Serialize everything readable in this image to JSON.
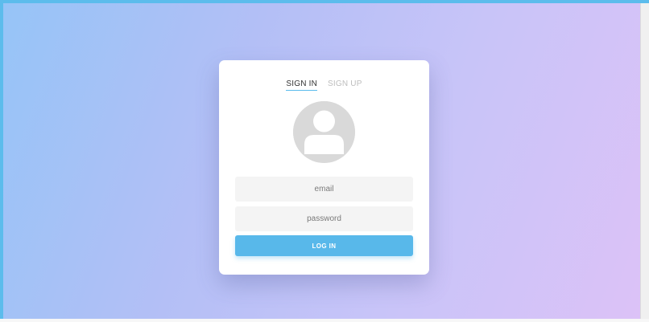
{
  "tabs": {
    "sign_in": "SIGN IN",
    "sign_up": "SIGN UP"
  },
  "form": {
    "email_placeholder": "email",
    "password_placeholder": "password",
    "login_label": "LOG IN"
  },
  "avatar": {
    "icon": "user-avatar-icon"
  },
  "colors": {
    "accent": "#58b8ea",
    "frame": "#5cbcec",
    "gradient_start": "#96c4f7",
    "gradient_end": "#dcc2f7",
    "field_background": "#f4f4f4",
    "avatar_background": "#d9d9d9"
  }
}
